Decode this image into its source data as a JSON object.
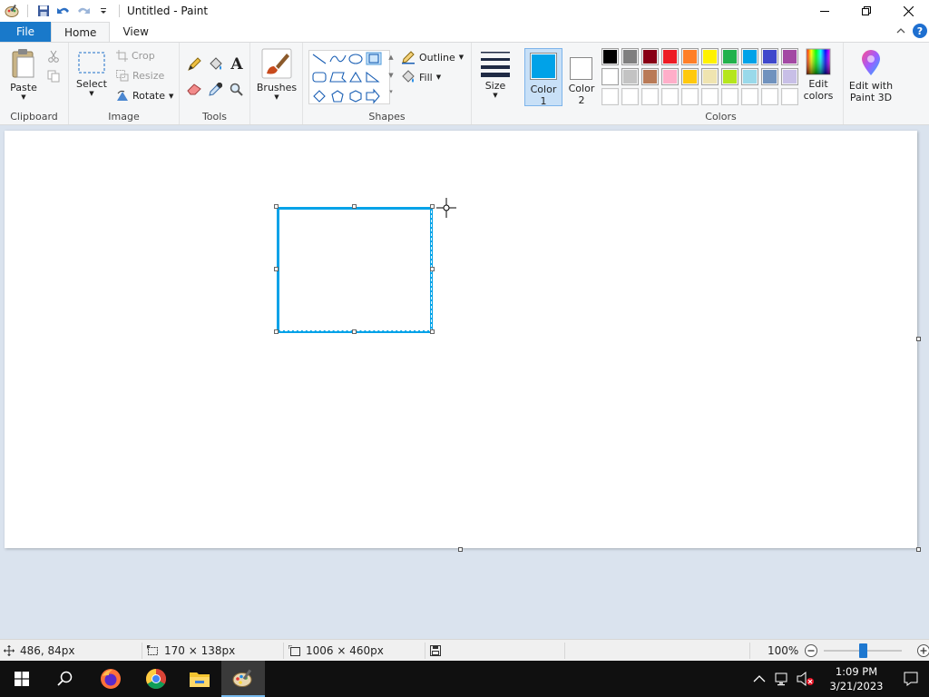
{
  "window": {
    "title": "Untitled - Paint"
  },
  "tabs": {
    "file": "File",
    "home": "Home",
    "view": "View"
  },
  "ribbon": {
    "clipboard": {
      "paste": "Paste",
      "group_label": "Clipboard"
    },
    "image": {
      "select": "Select",
      "crop": "Crop",
      "resize": "Resize",
      "rotate": "Rotate",
      "group_label": "Image"
    },
    "tools": {
      "group_label": "Tools"
    },
    "brushes": {
      "label": "Brushes"
    },
    "shapes": {
      "outline": "Outline",
      "fill": "Fill",
      "group_label": "Shapes"
    },
    "size": {
      "label": "Size"
    },
    "color1": {
      "label_line1": "Color",
      "label_line2": "1",
      "color": "#00a2e8"
    },
    "color2": {
      "label_line1": "Color",
      "label_line2": "2",
      "color": "#ffffff"
    },
    "colors": {
      "group_label": "Colors",
      "palette_row1": [
        "#000000",
        "#7f7f7f",
        "#880015",
        "#ed1c24",
        "#ff7f27",
        "#fff200",
        "#22b14c",
        "#00a2e8",
        "#3f48cc",
        "#a349a4"
      ],
      "palette_row2": [
        "#ffffff",
        "#c3c3c3",
        "#b97a57",
        "#ffaec9",
        "#ffc90e",
        "#efe4b0",
        "#b5e61d",
        "#99d9ea",
        "#7092be",
        "#c8bfe7"
      ],
      "palette_row3": [
        "#ffffff",
        "#ffffff",
        "#ffffff",
        "#ffffff",
        "#ffffff",
        "#ffffff",
        "#ffffff",
        "#ffffff",
        "#ffffff",
        "#ffffff"
      ],
      "edit_colors_line1": "Edit",
      "edit_colors_line2": "colors"
    },
    "paint3d": {
      "line1": "Edit with",
      "line2": "Paint 3D"
    }
  },
  "status": {
    "cursor_pos": "486, 84px",
    "selection_size": "170 × 138px",
    "canvas_size": "1006 × 460px",
    "zoom": "100%",
    "zoom_fraction": 0.5
  },
  "taskbar": {
    "time": "1:09 PM",
    "date": "3/21/2023"
  }
}
